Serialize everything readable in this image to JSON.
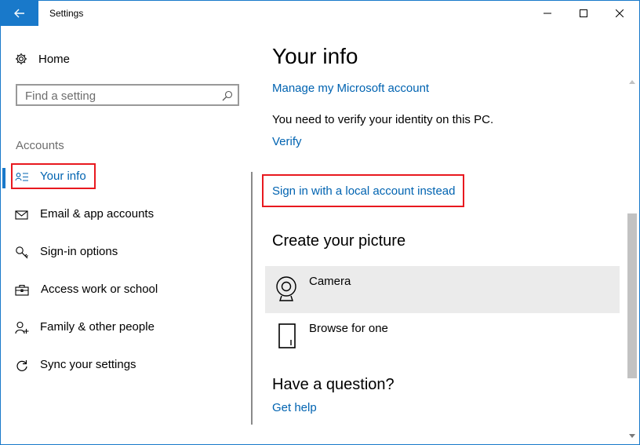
{
  "window": {
    "title": "Settings",
    "controls": {
      "minimize": "minimize",
      "maximize": "maximize",
      "close": "close"
    }
  },
  "sidebar": {
    "home_label": "Home",
    "search": {
      "placeholder": "Find a setting"
    },
    "section_heading": "Accounts",
    "items": [
      {
        "label": "Your info",
        "icon": "your-info-icon",
        "active": true
      },
      {
        "label": "Email & app accounts",
        "icon": "email-icon",
        "active": false
      },
      {
        "label": "Sign-in options",
        "icon": "key-icon",
        "active": false
      },
      {
        "label": "Access work or school",
        "icon": "briefcase-icon",
        "active": false
      },
      {
        "label": "Family & other people",
        "icon": "person-add-icon",
        "active": false
      },
      {
        "label": "Sync your settings",
        "icon": "sync-icon",
        "active": false
      }
    ]
  },
  "main": {
    "title": "Your info",
    "manage_link": "Manage my Microsoft account",
    "verify_text": "You need to verify your identity on this PC.",
    "verify_link": "Verify",
    "local_account_link": "Sign in with a local account instead",
    "picture_heading": "Create your picture",
    "picture_options": [
      {
        "label": "Camera",
        "icon": "camera-icon"
      },
      {
        "label": "Browse for one",
        "icon": "browse-icon"
      }
    ],
    "question_heading": "Have a question?",
    "help_link": "Get help"
  },
  "colors": {
    "accent": "#1979ca",
    "link": "#0063b1",
    "highlight_box": "#e8191f",
    "hover_row": "#ebebeb"
  }
}
